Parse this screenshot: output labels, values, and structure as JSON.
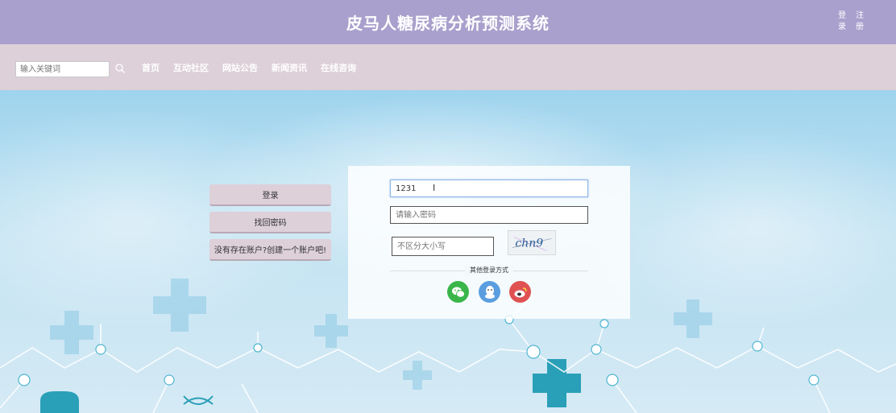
{
  "header": {
    "title": "皮马人糖尿病分析预测系统",
    "login_char1": "登",
    "login_char2": "录",
    "register_char1": "注",
    "register_char2": "册"
  },
  "search": {
    "placeholder": "输入关键词"
  },
  "nav": {
    "items": [
      "首页",
      "互动社区",
      "网站公告",
      "新闻资讯",
      "在线咨询"
    ]
  },
  "side_buttons": {
    "login": "登录",
    "forgot": "找回密码",
    "register": "没有存在账户?创建一个账户吧!"
  },
  "form": {
    "username_value": "1231",
    "password_placeholder": "请输入密码",
    "captcha_placeholder": "不区分大小写",
    "captcha_text": "chn9",
    "other_login_label": "其他登录方式"
  },
  "social": [
    "wechat-icon",
    "qq-icon",
    "weibo-icon"
  ],
  "colors": {
    "header_bg": "#a9a0cd",
    "nav_bg": "#ddd0d9",
    "wechat": "#3ab54a",
    "qq": "#5a9ee0",
    "weibo": "#e05252"
  }
}
